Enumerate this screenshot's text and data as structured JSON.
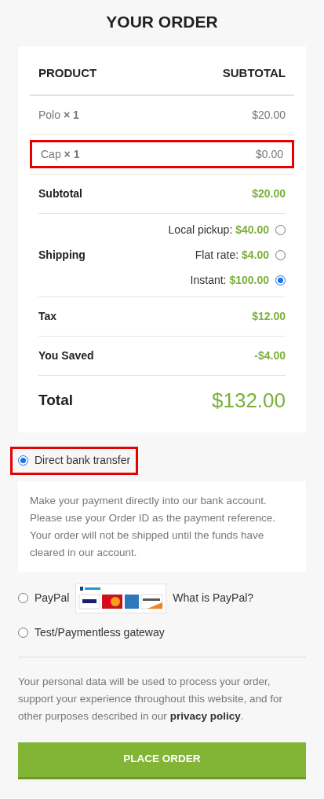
{
  "title": "YOUR ORDER",
  "table": {
    "columns": [
      "PRODUCT",
      "SUBTOTAL"
    ],
    "items": [
      {
        "name": "Polo",
        "qty": "× 1",
        "price": "$20.00",
        "highlighted": false
      },
      {
        "name": "Cap",
        "qty": "× 1",
        "price": "$0.00",
        "highlighted": true
      }
    ],
    "subtotal": {
      "label": "Subtotal",
      "value": "$20.00"
    },
    "shipping": {
      "label": "Shipping",
      "options": [
        {
          "label": "Local pickup:",
          "price": "$40.00",
          "selected": false
        },
        {
          "label": "Flat rate:",
          "price": "$4.00",
          "selected": false
        },
        {
          "label": "Instant:",
          "price": "$100.00",
          "selected": true
        }
      ]
    },
    "tax": {
      "label": "Tax",
      "value": "$12.00"
    },
    "saved": {
      "label": "You Saved",
      "value": "-$4.00"
    },
    "total": {
      "label": "Total",
      "value": "$132.00"
    }
  },
  "payment_methods": [
    {
      "kind": "bank",
      "label": "Direct bank transfer",
      "selected": true,
      "highlighted": true,
      "description": "Make your payment directly into our bank account. Please use your Order ID as the payment reference. Your order will not be shipped until the funds have cleared in our account."
    },
    {
      "kind": "paypal",
      "label": "PayPal",
      "selected": false,
      "highlighted": false,
      "link": "What is PayPal?"
    },
    {
      "kind": "plain",
      "label": "Test/Paymentless gateway",
      "selected": false,
      "highlighted": false
    }
  ],
  "privacy": {
    "text": "Your personal data will be used to process your order, support your experience throughout this website, and for other purposes described in our",
    "link": "privacy policy",
    "end": "."
  },
  "button": "PLACE ORDER"
}
